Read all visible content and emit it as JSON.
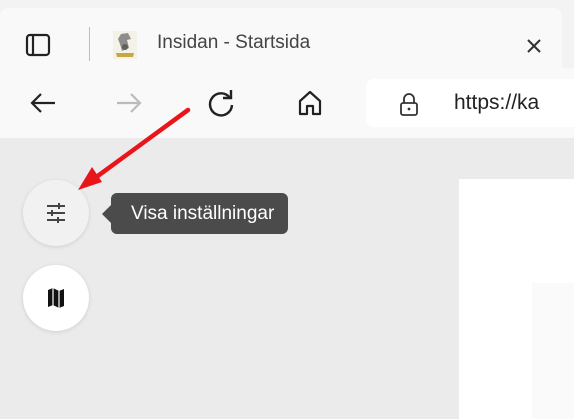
{
  "browser": {
    "tab": {
      "title": "Insidan - Startsida",
      "favicon_icon": "knight-favicon-icon",
      "close_icon": "close-icon"
    },
    "tab_actions_icon": "tab-actions-icon",
    "toolbar": {
      "back_icon": "arrow-left-icon",
      "forward_icon": "arrow-right-icon",
      "refresh_icon": "refresh-icon",
      "home_icon": "home-icon",
      "lock_icon": "lock-icon",
      "url": "https://ka"
    }
  },
  "page": {
    "settings_button_icon": "sliders-icon",
    "map_button_icon": "map-icon",
    "tooltip": "Visa inställningar"
  },
  "annotation": {
    "arrow_color": "#e8161b",
    "description_icon": "red-arrow-icon"
  },
  "colors": {
    "page_background": "#ebebeb",
    "tooltip_background": "#4b4b4b"
  }
}
